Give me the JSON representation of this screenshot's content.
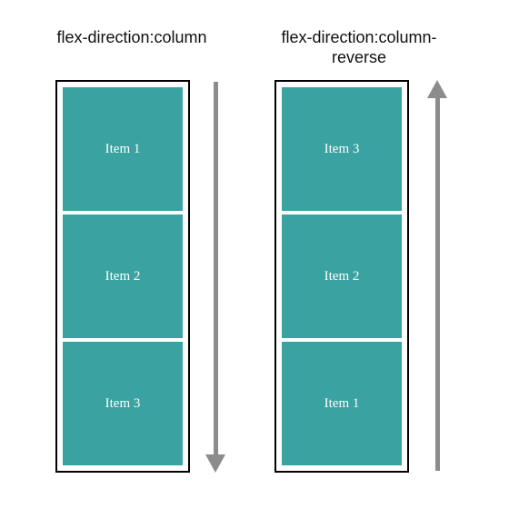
{
  "left": {
    "heading": "flex-direction:column",
    "items": [
      "Item 1",
      "Item 2",
      "Item 3"
    ],
    "arrow_direction": "down"
  },
  "right": {
    "heading": "flex-direction:column-reverse",
    "items": [
      "Item 3",
      "Item 2",
      "Item 1"
    ],
    "arrow_direction": "up"
  },
  "colors": {
    "item_fill": "#3aa2a0",
    "arrow": "#8c8c8c"
  }
}
